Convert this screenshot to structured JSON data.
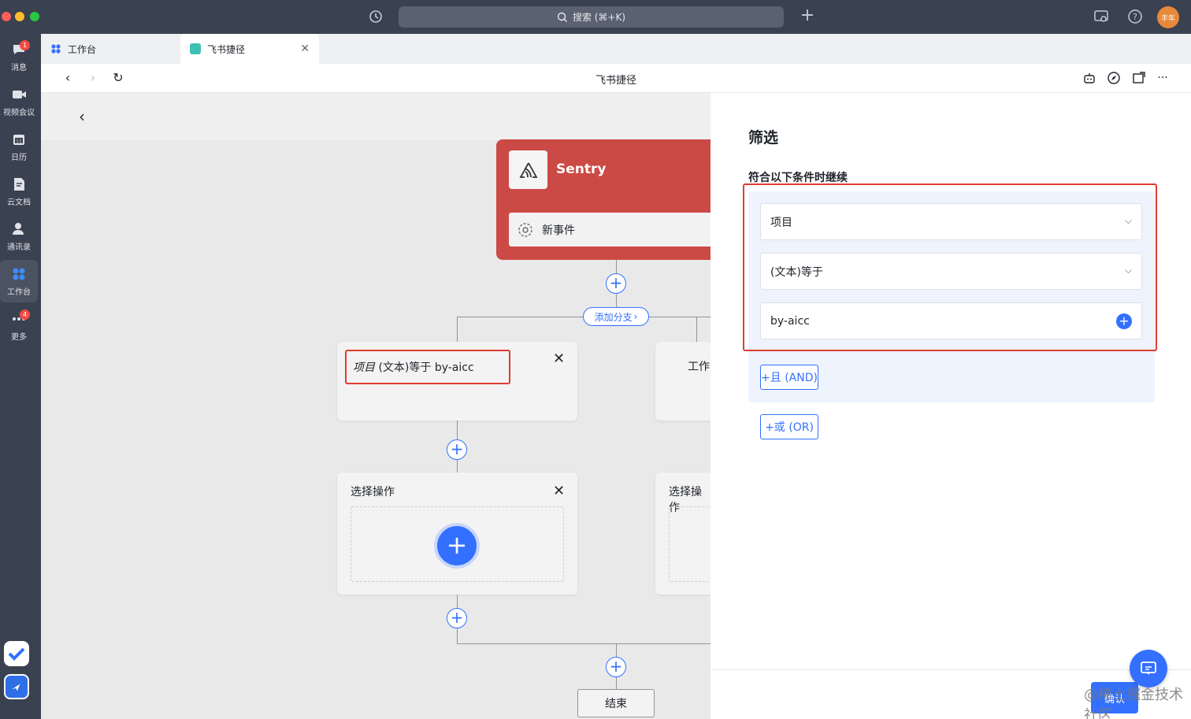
{
  "titlebar": {
    "search_label": "搜索 (⌘+K)",
    "avatar_text": "丰年"
  },
  "rail": {
    "items": [
      {
        "label": "消息",
        "badge": "1"
      },
      {
        "label": "视频会议"
      },
      {
        "label": "日历"
      },
      {
        "label": "云文档"
      },
      {
        "label": "通讯录"
      },
      {
        "label": "工作台"
      },
      {
        "label": "更多",
        "badge": "4"
      }
    ]
  },
  "tabs": [
    {
      "label": "工作台"
    },
    {
      "label": "飞书捷径"
    }
  ],
  "navbar": {
    "title": "飞书捷径"
  },
  "canvas": {
    "trigger": {
      "title": "Sentry",
      "event": "新事件"
    },
    "branch_label": "添加分支",
    "condition": {
      "field": "项目",
      "rest": " (文本)等于 by-aicc"
    },
    "card_right_label": "工作",
    "action_label": "选择操作",
    "action_label_right": "选择操作",
    "end_label": "结束"
  },
  "panel": {
    "title": "筛选",
    "subtitle": "符合以下条件时继续",
    "field1": "项目",
    "field2": "(文本)等于",
    "field3": "by-aicc",
    "and_label": "+且 (AND)",
    "or_label": "+或 (OR)",
    "confirm_label": "确认"
  },
  "watermark": "@稀土掘金技术社区",
  "colors": {
    "accent": "#3370ff",
    "sentry": "#cc4a45",
    "highlight": "#e03c31"
  }
}
